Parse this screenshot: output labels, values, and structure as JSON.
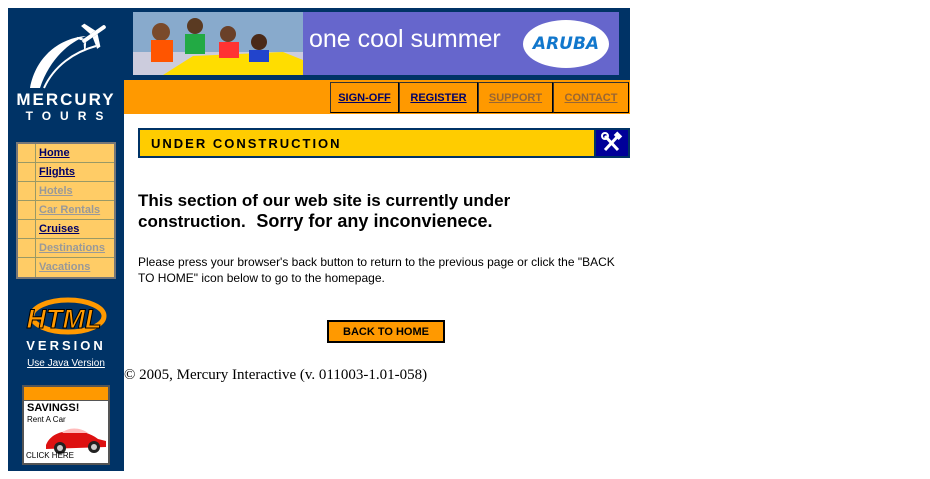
{
  "sidebar": {
    "logo_title": "MERCURY",
    "logo_subtitle": "TOURS",
    "nav": [
      {
        "label": "Home",
        "state": "active"
      },
      {
        "label": "Flights",
        "state": "active"
      },
      {
        "label": "Hotels",
        "state": "dim"
      },
      {
        "label": "Car Rentals",
        "state": "dim"
      },
      {
        "label": "Cruises",
        "state": "active"
      },
      {
        "label": "Destinations",
        "state": "dim"
      },
      {
        "label": "Vacations",
        "state": "dim"
      }
    ],
    "badge_line1": "HTML",
    "badge_line2": "VERSION",
    "java_link": "Use Java Version",
    "ad": {
      "title": "SAVINGS!",
      "subtitle": "Rent A Car",
      "cta": "CLICK HERE"
    }
  },
  "banner": {
    "text": "one cool summer",
    "brand": "ARUBA"
  },
  "topnav": {
    "signoff": "SIGN-OFF",
    "register": "REGISTER",
    "support": "SUPPORT",
    "contact": "CONTACT"
  },
  "main": {
    "section_title": "UNDER CONSTRUCTION",
    "headline_part1": "This section of our web site is currently under construction.",
    "headline_part2": "Sorry for any inconvienece.",
    "body": "Please press your browser's back button to return to the previous page or click the \"BACK TO HOME\" icon below to go to the homepage.",
    "back_button": "BACK TO HOME"
  },
  "footer": {
    "copyright": "© 2005, Mercury Interactive (v. 011003-1.01-058)"
  },
  "colors": {
    "navy": "#003366",
    "orange": "#ff9900",
    "yellow": "#ffcc00",
    "nav_bg": "#ffcc66"
  }
}
